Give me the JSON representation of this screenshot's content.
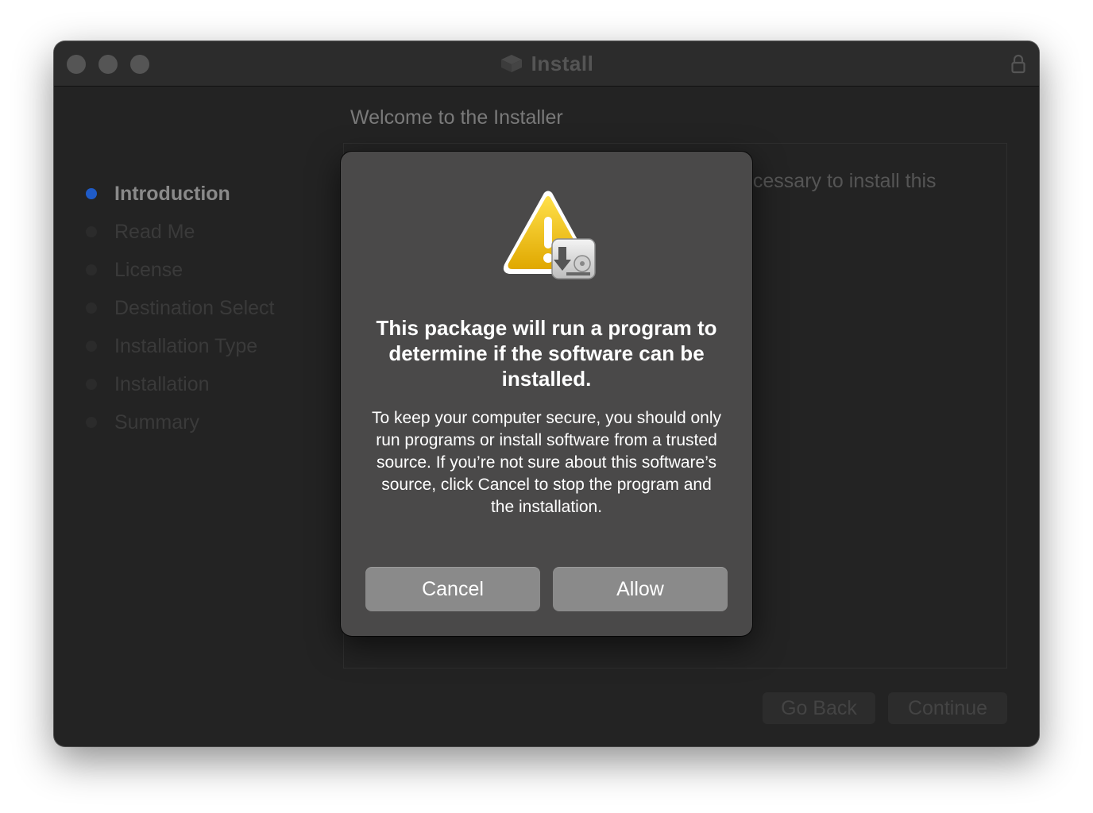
{
  "window": {
    "title": "Install"
  },
  "sidebar": {
    "steps": [
      {
        "label": "Introduction",
        "active": true
      },
      {
        "label": "Read Me",
        "active": false
      },
      {
        "label": "License",
        "active": false
      },
      {
        "label": "Destination Select",
        "active": false
      },
      {
        "label": "Installation Type",
        "active": false
      },
      {
        "label": "Installation",
        "active": false
      },
      {
        "label": "Summary",
        "active": false
      }
    ]
  },
  "main": {
    "welcome": "Welcome to the  Installer",
    "content_fragment": "ecessary to install this"
  },
  "footer": {
    "back_label": "Go Back",
    "continue_label": "Continue"
  },
  "dialog": {
    "title": "This package will run a program to determine if the software can be installed.",
    "body": "To keep your computer secure, you should only run programs or install software from a trusted source. If you’re not sure about this software’s source, click Cancel to stop the program and the installation.",
    "cancel_label": "Cancel",
    "allow_label": "Allow",
    "icon": "warning-installer-icon"
  },
  "colors": {
    "accent": "#1f5bc7",
    "warning": "#f2c218",
    "window_bg": "#232323",
    "dialog_bg": "#4a4949",
    "dialog_button": "#8a8a8a"
  }
}
